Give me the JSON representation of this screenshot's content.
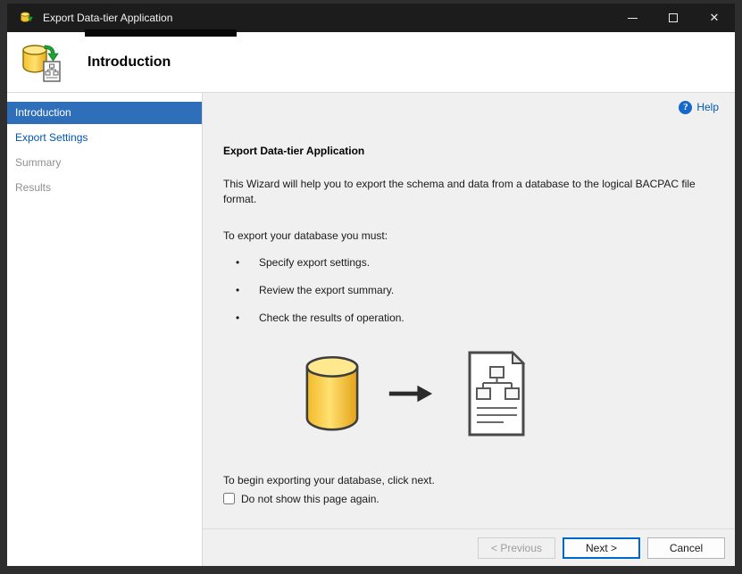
{
  "window": {
    "title": "Export Data-tier Application",
    "controls": {
      "minimize": "minimize",
      "maximize": "maximize",
      "close": "✕"
    }
  },
  "header": {
    "title": "Introduction"
  },
  "sidebar": {
    "items": [
      {
        "label": "Introduction",
        "state": "active"
      },
      {
        "label": "Export Settings",
        "state": "link"
      },
      {
        "label": "Summary",
        "state": "disabled"
      },
      {
        "label": "Results",
        "state": "disabled"
      }
    ]
  },
  "content": {
    "help_label": "Help",
    "help_glyph": "?",
    "heading": "Export Data-tier Application",
    "intro": "This Wizard will help you to export the schema and data from a database to the logical BACPAC file format.",
    "must_line": "To export your database you must:",
    "bullet_char": "•",
    "bullets": [
      "Specify export settings.",
      "Review the export summary.",
      "Check the results of operation."
    ],
    "footer_note": "To begin exporting your database, click next.",
    "checkbox_label": "Do not show this page again.",
    "checkbox_checked": false
  },
  "buttons": {
    "previous": "< Previous",
    "next": "Next >",
    "cancel": "Cancel"
  },
  "colors": {
    "titlebar_bg": "#1c1c1c",
    "frame": "#2e2e2e",
    "accent": "#2f6fba",
    "link": "#0057b0",
    "content_bg": "#f0f0f0",
    "next_border": "#0068c8"
  }
}
